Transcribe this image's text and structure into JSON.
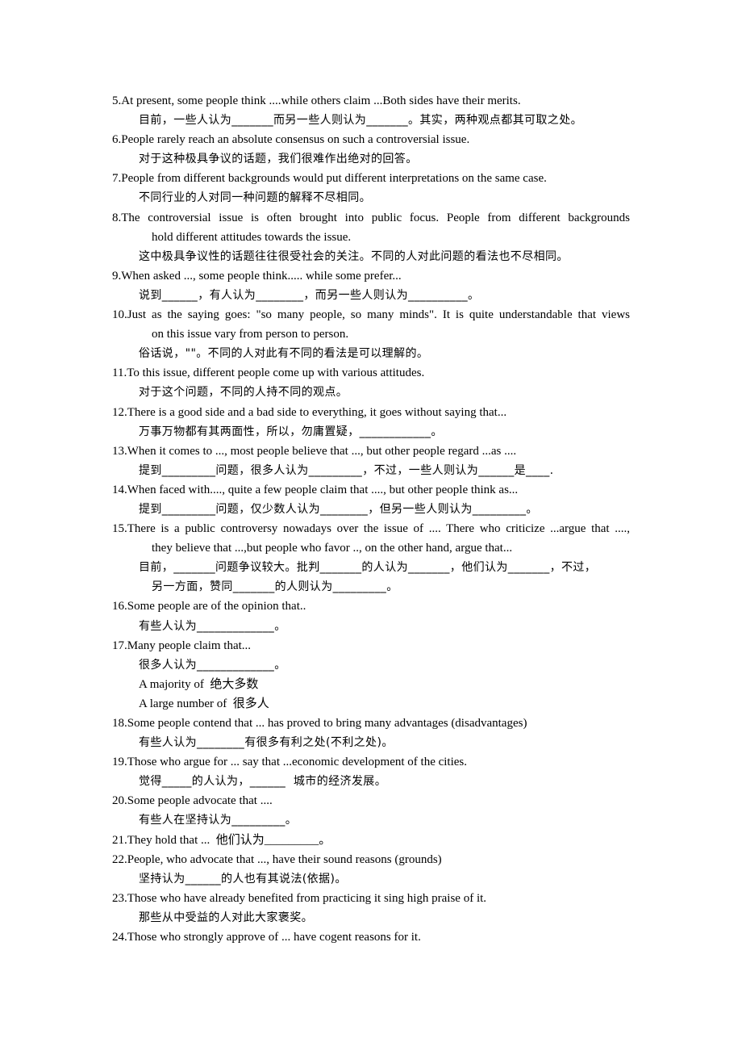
{
  "document": {
    "entries": [
      {
        "number": "5.",
        "english": [
          "At present, some people think ....while others claim ...Both sides have their merits."
        ],
        "chinese": [
          "目前，一些人认为_______而另一些人则认为_______。其实，两种观点都其可取之处。"
        ]
      },
      {
        "number": "6.",
        "english": [
          "People rarely reach an absolute consensus on such a controversial issue."
        ],
        "chinese": [
          "对于这种极具争议的话题，我们很难作出绝对的回答。"
        ]
      },
      {
        "number": "7.",
        "english": [
          "People from different backgrounds would put different interpretations on the same case."
        ],
        "chinese": [
          "不同行业的人对同一种问题的解释不尽相同。"
        ]
      },
      {
        "number": "8.",
        "english": [
          "The controversial issue is often brought into public focus. People from different backgrounds",
          "hold different attitudes towards the issue."
        ],
        "chinese": [
          "这中极具争议性的话题往往很受社会的关注。不同的人对此问题的看法也不尽相同。"
        ]
      },
      {
        "number": "9.",
        "english": [
          "When asked ..., some people think..... while some prefer..."
        ],
        "chinese": [
          "说到______，有人认为________，而另一些人则认为__________。"
        ]
      },
      {
        "number": "10.",
        "english": [
          "Just as the saying goes: \"so many people, so many minds\". It is quite understandable that views",
          "on this issue vary from person to person."
        ],
        "chinese": [
          "俗话说，\"\"。不同的人对此有不同的看法是可以理解的。"
        ]
      },
      {
        "number": "11.",
        "english": [
          "To this issue, different people come up with various attitudes."
        ],
        "chinese": [
          "对于这个问题，不同的人持不同的观点。"
        ]
      },
      {
        "number": "12.",
        "english": [
          "There is a good side and a bad side to everything, it goes without saying that..."
        ],
        "chinese": [
          "万事万物都有其两面性，所以，勿庸置疑，____________。"
        ]
      },
      {
        "number": "13.",
        "english": [
          "When it comes to ..., most people believe that ..., but other people regard ...as ...."
        ],
        "chinese": [
          "提到_________问题，很多人认为_________，不过，一些人则认为______是____."
        ]
      },
      {
        "number": "14.",
        "english": [
          "When faced with...., quite a few people claim that ...., but other people think as..."
        ],
        "chinese": [
          "提到_________问题，仅少数人认为________，但另一些人则认为_________。"
        ]
      },
      {
        "number": "15.",
        "english": [
          "There is a public controversy nowadays over the issue of .... There who criticize ...argue that ....,",
          "they believe that ...,but people who favor .., on the other hand, argue that..."
        ],
        "chinese": [
          "目前，_______问题争议较大。批判_______的人认为_______，他们认为_______，不过，",
          "另一方面，赞同_______的人则认为_________。"
        ]
      },
      {
        "number": "16.",
        "english": [
          "Some people are of the opinion that.."
        ],
        "chinese": [
          "有些人认为_____________。"
        ]
      },
      {
        "number": "17.",
        "english": [
          "Many people claim that..."
        ],
        "chinese": [
          "很多人认为_____________。"
        ],
        "extras": [
          "A majority of  绝大多数",
          "A large number of  很多人"
        ]
      },
      {
        "number": "18.",
        "english": [
          "Some people contend that ... has proved to bring many advantages (disadvantages)"
        ],
        "chinese": [
          "有些人认为________有很多有利之处(不利之处)。"
        ]
      },
      {
        "number": "19.",
        "english": [
          "Those who argue for ... say that ...economic development of the cities."
        ],
        "chinese": [
          "觉得_____的人认为，______  城市的经济发展。"
        ]
      },
      {
        "number": "20.",
        "english": [
          "Some people advocate that ...."
        ],
        "chinese": [
          "有些人在坚持认为_________。"
        ]
      },
      {
        "number": "21.",
        "english": [
          "They hold that ...  他们认为_________。"
        ],
        "chinese": []
      },
      {
        "number": "22.",
        "english": [
          "People, who advocate that ..., have their sound reasons (grounds)"
        ],
        "chinese": [
          "坚持认为______的人也有其说法(依据)。"
        ]
      },
      {
        "number": "23.",
        "english": [
          "Those who have already benefited from practicing it sing high praise of it."
        ],
        "chinese": [
          "那些从中受益的人对此大家褒奖。"
        ]
      },
      {
        "number": "24.",
        "english": [
          "Those who strongly approve of ... have cogent reasons for it."
        ],
        "chinese": []
      }
    ]
  }
}
